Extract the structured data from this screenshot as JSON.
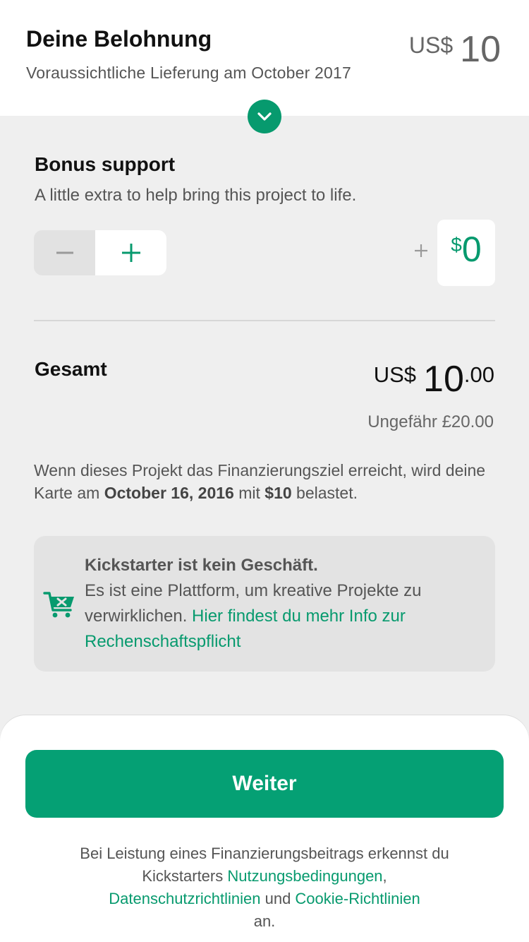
{
  "reward": {
    "title": "Deine Belohnung",
    "delivery": "Voraussichtliche Lieferung am October 2017",
    "currency": "US$",
    "amount": "10"
  },
  "icons": {
    "collapse": "chevron-down-icon",
    "decrement": "minus-icon",
    "increment": "plus-icon",
    "add": "plus-icon",
    "info": "shopping-cart-x-icon"
  },
  "bonus": {
    "title": "Bonus support",
    "description": "A little extra to help bring this project to life.",
    "amount_currency": "$",
    "amount_value": "0"
  },
  "total": {
    "label": "Gesamt",
    "currency": "US$",
    "integer": "10",
    "decimal": ".00",
    "approx": "Ungefähr £20.00"
  },
  "charge_note": {
    "part1": "Wenn dieses Projekt das Finanzierungsziel erreicht, wird deine Karte am ",
    "date": "October 16, 2016",
    "part2": " mit ",
    "amount": "$10",
    "part3": " belastet."
  },
  "info_card": {
    "title": "Kickstarter ist kein Geschäft.",
    "text": "Es ist eine Plattform, um kreative Projekte zu verwirklichen. ",
    "link": "Hier findest du mehr Info zur Rechenschaftspflicht"
  },
  "footer": {
    "button_label": "Weiter",
    "legal_part1": "Bei Leistung eines Finanzierungsbeitrags erkennst du Kickstarters ",
    "terms_link": "Nutzungsbedingungen",
    "comma": ",",
    "privacy_link": "Datenschutzrichtlinien",
    "and": " und ",
    "cookie_link": "Cookie-Richtlinien",
    "legal_end": "an."
  },
  "colors": {
    "accent": "#079a6e",
    "button": "#05a074",
    "background": "#efefef"
  }
}
